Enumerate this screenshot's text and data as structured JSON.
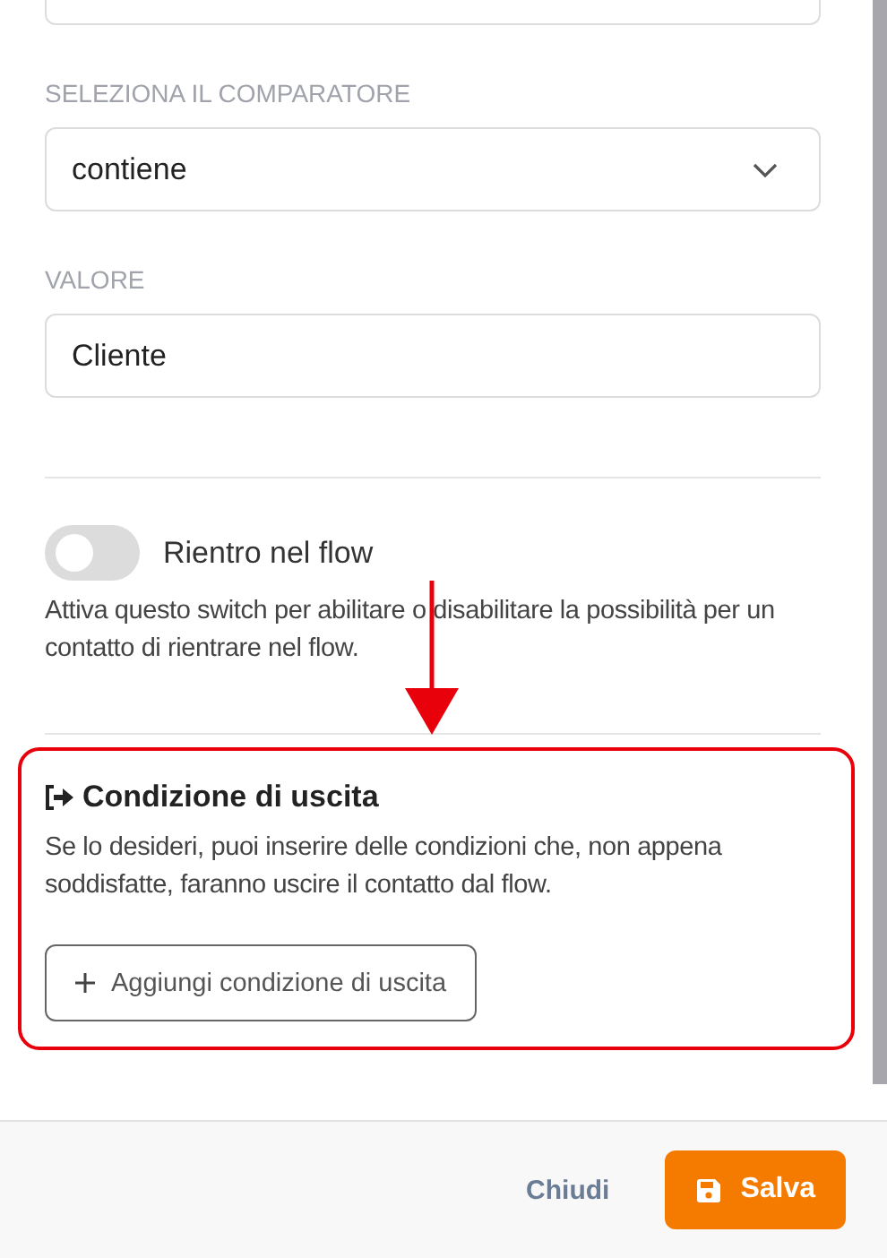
{
  "fields": [
    {
      "kind": "partial"
    },
    {
      "kind": "select",
      "label": "SELEZIONA IL COMPARATORE",
      "value": "contiene"
    },
    {
      "kind": "text",
      "label": "VALORE",
      "value": "Cliente"
    }
  ],
  "reentry": {
    "label": "Rientro nel flow",
    "on": false,
    "description": "Attiva questo switch per abilitare o disabilitare la possibilità per un contatto di rientrare nel flow."
  },
  "exit_condition": {
    "title": "Condizione di uscita",
    "description": "Se lo desideri, puoi inserire delle condizioni che, non appena soddisfatte, faranno uscire il contatto dal flow.",
    "button": "Aggiungi condizione di uscita"
  },
  "footer": {
    "buttons": [
      {
        "label": "Chiudi",
        "kind": "secondary"
      },
      {
        "label": "Salva",
        "kind": "primary"
      }
    ]
  }
}
